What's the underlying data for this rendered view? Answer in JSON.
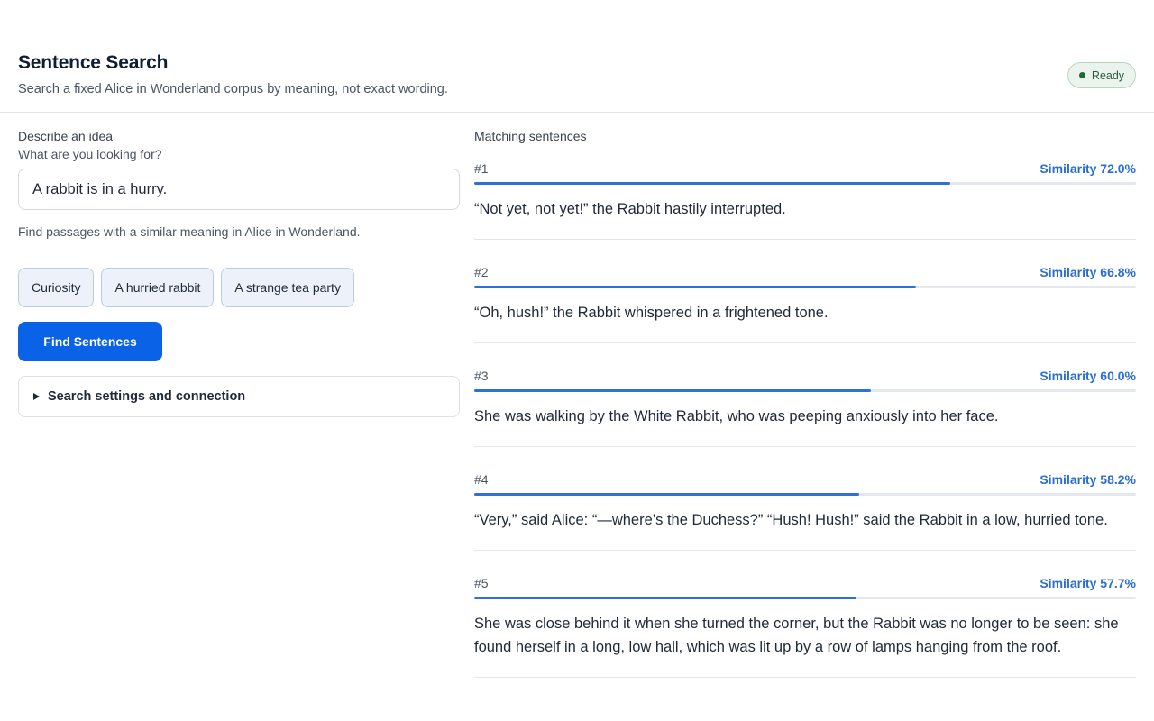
{
  "header": {
    "title": "Sentence Search",
    "subtitle": "Search a fixed Alice in Wonderland corpus by meaning, not exact wording.",
    "status": "Ready",
    "status_color": "#1f6b36"
  },
  "query": {
    "label": "Describe an idea",
    "sublabel": "What are you looking for?",
    "value": "A rabbit is in a hurry.",
    "hint": "Find passages with a similar meaning in Alice in Wonderland."
  },
  "chips": [
    "Curiosity",
    "A hurried rabbit",
    "A strange tea party"
  ],
  "actions": {
    "find_label": "Find Sentences",
    "settings_label": "Search settings and connection"
  },
  "results": {
    "heading": "Matching sentences",
    "items": [
      {
        "rank": "#1",
        "similarity_label": "Similarity 72.0%",
        "similarity": 0.72,
        "text": "“Not yet, not yet!” the Rabbit hastily interrupted."
      },
      {
        "rank": "#2",
        "similarity_label": "Similarity 66.8%",
        "similarity": 0.668,
        "text": "“Oh, hush!” the Rabbit whispered in a frightened tone."
      },
      {
        "rank": "#3",
        "similarity_label": "Similarity 60.0%",
        "similarity": 0.6,
        "text": "She was walking by the White Rabbit, who was peeping anxiously into her face."
      },
      {
        "rank": "#4",
        "similarity_label": "Similarity 58.2%",
        "similarity": 0.582,
        "text": "“Very,” said Alice: “—where’s the Duchess?” “Hush! Hush!” said the Rabbit in a low, hurried tone."
      },
      {
        "rank": "#5",
        "similarity_label": "Similarity 57.7%",
        "similarity": 0.577,
        "text": "She was close behind it when she turned the corner, but the Rabbit was no longer to be seen: she found herself in a long, low hall, which was lit up by a row of lamps hanging from the roof."
      }
    ]
  },
  "colors": {
    "accent": "#0a62e6",
    "similarity_bar": "#2f6fd8",
    "chip_border": "#b8ccea"
  }
}
